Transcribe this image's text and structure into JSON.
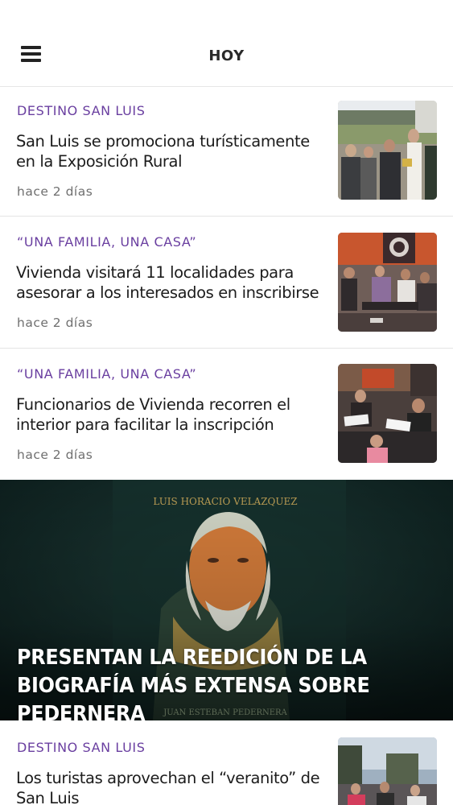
{
  "header": {
    "title": "HOY"
  },
  "articles": [
    {
      "category": "DESTINO SAN LUIS",
      "headline": "San Luis se promociona turísticamente en la Exposición Rural",
      "time": "hace 2 días"
    },
    {
      "category": "“UNA FAMILIA, UNA CASA”",
      "headline": "Vivienda visitará 11 localidades para asesorar a los interesados en inscribirse",
      "time": "hace 2 días"
    },
    {
      "category": "“UNA FAMILIA, UNA CASA”",
      "headline": "Funcionarios de Vivienda recorren el interior para facilitar la inscripción",
      "time": "hace 2 días"
    }
  ],
  "feature": {
    "headline": "PRESENTAN LA REEDICIÓN DE LA BIOGRAFÍA MÁS EXTENSA SOBRE PEDERNERA",
    "book_author": "LUIS HORACIO VELAZQUEZ",
    "book_subtitle": "JUAN ESTEBAN PEDERNERA"
  },
  "last_article": {
    "category": "DESTINO SAN LUIS",
    "headline": "Los turistas aprovechan el “veranito” de San Luis"
  },
  "colors": {
    "accent": "#6a3fa0",
    "feature_bg": "#0f2422"
  }
}
